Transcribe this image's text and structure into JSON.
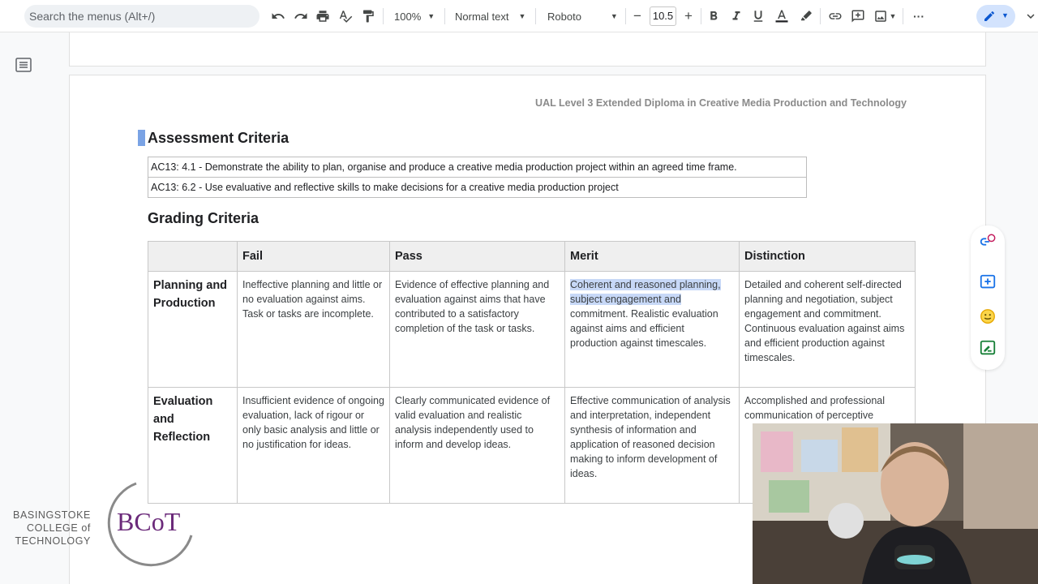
{
  "toolbar": {
    "search_placeholder": "Search the menus (Alt+/)",
    "zoom": "100%",
    "style": "Normal text",
    "font": "Roboto",
    "font_size": "10.5",
    "minus": "−",
    "plus": "+",
    "more": "···",
    "accent_color": "#d3e3fd"
  },
  "document": {
    "header": "UAL Level 3 Extended Diploma in Creative Media Production and Technology",
    "assessment_title": "Assessment Criteria",
    "assessment_rows": [
      "AC13: 4.1 - Demonstrate the ability to plan, organise and produce a creative media production project within an agreed time frame.",
      "AC13: 6.2 - Use evaluative and reflective skills to make decisions for a creative media production project"
    ],
    "grading_title": "Grading Criteria",
    "grading_headers": [
      "",
      "Fail",
      "Pass",
      "Merit",
      "Distinction"
    ],
    "grading_rows": [
      {
        "label": "Planning and Production",
        "fail": "Ineffective planning and little or no evaluation against aims. Task or tasks are incomplete.",
        "pass": "Evidence of effective planning and evaluation against aims that have contributed to a satisfactory completion of the task or tasks.",
        "merit_selected": "Coherent and reasoned planning, subject engagement and",
        "merit_rest": " commitment. Realistic evaluation against aims and efficient production against timescales.",
        "distinction": "Detailed and coherent self-directed planning and negotiation, subject engagement and commitment. Continuous evaluation against aims and efficient production against timescales."
      },
      {
        "label": "Evaluation and Reflection",
        "fail": "Insufficient evidence of ongoing evaluation, lack of rigour or only basic analysis and little or no justification for ideas.",
        "pass": "Clearly communicated evidence of valid evaluation and realistic analysis independently used to inform and develop ideas.",
        "merit": "Effective communication of analysis and interpretation, independent synthesis of information and application of reasoned decision making to inform development of ideas.",
        "distinction": "Accomplished and professional communication of perceptive"
      }
    ]
  },
  "logo": {
    "line1": "BASINGSTOKE",
    "line2": "COLLEGE of",
    "line3": "TECHNOLOGY",
    "mark": "BCoT",
    "brand_color": "#6b2a7a"
  }
}
